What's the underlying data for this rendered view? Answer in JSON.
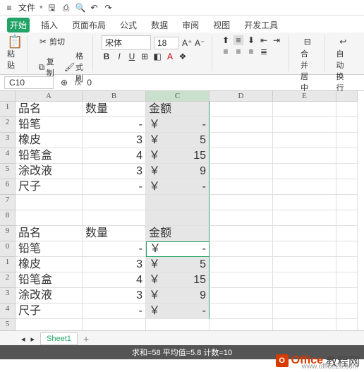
{
  "menubar": {
    "file": "文件"
  },
  "tabs": [
    "开始",
    "插入",
    "页面布局",
    "公式",
    "数据",
    "审阅",
    "视图",
    "开发工具"
  ],
  "ribbon": {
    "paste": "粘贴",
    "cut": "剪切",
    "copy": "复制",
    "format_painter": "格式刷",
    "font_name": "宋体",
    "font_size": "18",
    "merge_center": "合并居中",
    "wrap": "自动换行"
  },
  "namebox": {
    "ref": "C10",
    "formula": "0"
  },
  "columns": [
    "A",
    "B",
    "C",
    "D",
    "E"
  ],
  "rows": [
    "1",
    "2",
    "3",
    "4",
    "5",
    "6",
    "7",
    "8",
    "9",
    "0",
    "1",
    "2",
    "3",
    "4",
    "5"
  ],
  "cells": {
    "A1": "品名",
    "B1": "数量",
    "C1": "金额",
    "A2": "铅笔",
    "B2": "-",
    "C2y": "￥",
    "C2v": "-",
    "A3": "橡皮",
    "B3": "3",
    "C3y": "￥",
    "C3v": "5",
    "A4": "铅笔盒",
    "B4": "4",
    "C4y": "￥",
    "C4v": "15",
    "A5": "涂改液",
    "B5": "3",
    "C5y": "￥",
    "C5v": "9",
    "A6": "尺子",
    "B6": "-",
    "C6y": "￥",
    "C6v": "-",
    "A9": "品名",
    "B9": "数量",
    "C9": "金额",
    "A10": "铅笔",
    "B10": "-",
    "C10y": "￥",
    "C10v": "-",
    "A11": "橡皮",
    "B11": "3",
    "C11y": "￥",
    "C11v": "5",
    "A12": "铅笔盒",
    "B12": "4",
    "C12y": "￥",
    "C12v": "15",
    "A13": "涂改液",
    "B13": "3",
    "C13y": "￥",
    "C13v": "9",
    "A14": "尺子",
    "B14": "-",
    "C14y": "￥",
    "C14v": "-"
  },
  "sheet": {
    "name": "Sheet1"
  },
  "status": "求和=58  平均值=5.8  计数=10",
  "watermark": {
    "t1": "Office",
    "t2": "教程网",
    "url": "www.office26.com"
  }
}
